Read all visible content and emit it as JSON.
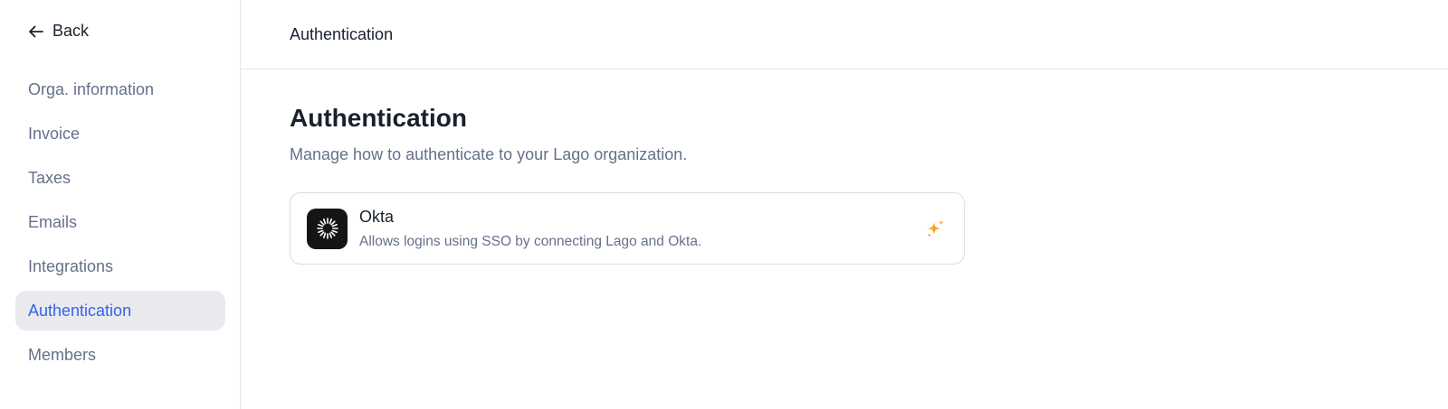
{
  "sidebar": {
    "back_label": "Back",
    "items": [
      {
        "label": "Orga. information"
      },
      {
        "label": "Invoice"
      },
      {
        "label": "Taxes"
      },
      {
        "label": "Emails"
      },
      {
        "label": "Integrations"
      },
      {
        "label": "Authentication",
        "active": true
      },
      {
        "label": "Members"
      }
    ]
  },
  "header": {
    "title": "Authentication"
  },
  "main": {
    "title": "Authentication",
    "subtitle": "Manage how to authenticate to your Lago organization.",
    "integrations": [
      {
        "name": "Okta",
        "description": "Allows logins using SSO by connecting Lago and Okta.",
        "logo_icon": "okta-logo-icon",
        "badge_icon": "sparkles-icon"
      }
    ]
  },
  "colors": {
    "accent": "#3662e8",
    "active_bg": "#e8eaee",
    "badge": "#f5a623"
  }
}
